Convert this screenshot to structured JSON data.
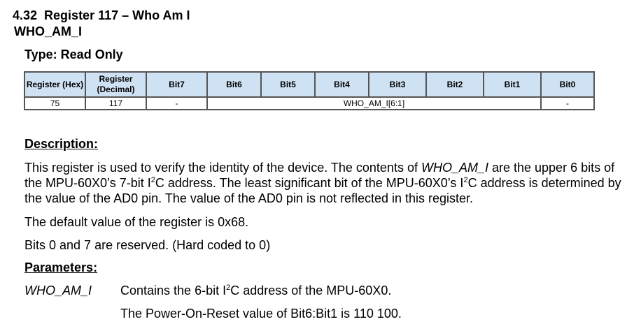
{
  "section": {
    "number": "4.32",
    "title": "Register 117 – Who Am I"
  },
  "register_name": "WHO_AM_I",
  "type_line": "Type: Read Only",
  "table": {
    "headers": [
      "Register (Hex)",
      "Register (Decimal)",
      "Bit7",
      "Bit6",
      "Bit5",
      "Bit4",
      "Bit3",
      "Bit2",
      "Bit1",
      "Bit0"
    ],
    "row": {
      "hex": "75",
      "decimal": "117",
      "bit7": "-",
      "field": "WHO_AM_I[6:1]",
      "bit0": "-"
    }
  },
  "description": {
    "heading": "Description:",
    "p1": {
      "a": "This register is used to verify the identity of the device. The contents of ",
      "b": "WHO_AM_I",
      "c": " are the upper 6 bits of the MPU-60X0’s 7-bit I",
      "sup1": "2",
      "d": "C address. The least significant bit of the MPU-60X0’s I",
      "sup2": "2",
      "e": "C address is determined by the value of the AD0 pin. The value of the AD0 pin is not reflected in this register."
    },
    "p2": "The default value of the register is 0x68.",
    "p3": "Bits 0 and 7 are reserved. (Hard coded to 0)"
  },
  "parameters": {
    "heading": "Parameters:",
    "name": "WHO_AM_I",
    "line1": {
      "a": "Contains the 6-bit I",
      "sup": "2",
      "b": "C address of the MPU-60X0."
    },
    "line2": "The Power-On-Reset value of Bit6:Bit1 is 110 100."
  }
}
